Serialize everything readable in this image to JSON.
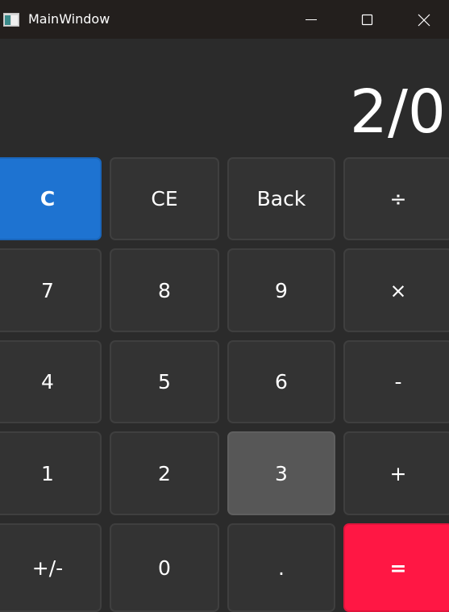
{
  "window": {
    "title": "MainWindow",
    "controls": {
      "minimize_icon": "minimize-icon",
      "maximize_icon": "maximize-icon",
      "close_icon": "close-icon"
    }
  },
  "display": {
    "value": "2/0"
  },
  "keypad": {
    "rows": [
      [
        "C",
        "CE",
        "Back",
        "÷"
      ],
      [
        "7",
        "8",
        "9",
        "×"
      ],
      [
        "4",
        "5",
        "6",
        "-"
      ],
      [
        "1",
        "2",
        "3",
        "+"
      ],
      [
        "+/-",
        "0",
        ".",
        "="
      ]
    ],
    "hovered_key": "3"
  },
  "colors": {
    "background": "#2b2b2b",
    "titlebar": "#231f1d",
    "key": "#333333",
    "key_hover": "#575757",
    "clear_key": "#1e73d1",
    "equals_key": "#ff1744"
  }
}
